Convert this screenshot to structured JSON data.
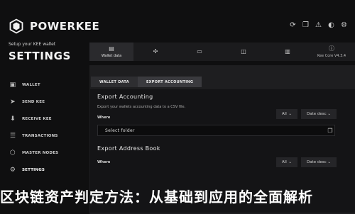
{
  "app": {
    "name": "POWERKEE",
    "subtitle": "Setup your KEE wallet",
    "page_title": "SETTINGS"
  },
  "top_icons": [
    "sync-icon",
    "copy-icon",
    "alert-icon",
    "brightness-icon",
    "settings-icon"
  ],
  "nav": [
    {
      "label": "WALLET",
      "icon": "wallet-icon"
    },
    {
      "label": "SEND KEE",
      "icon": "send-icon"
    },
    {
      "label": "RECEIVE KEE",
      "icon": "receive-icon"
    },
    {
      "label": "TRANSACTIONS",
      "icon": "transactions-icon"
    },
    {
      "label": "MASTER NODES",
      "icon": "masternodes-icon"
    },
    {
      "label": "SETTINGS",
      "icon": "settings-icon"
    }
  ],
  "tabs": [
    {
      "label": "Wallet data",
      "icon": "wallet-data-icon"
    },
    {
      "label": "",
      "icon": "network-icon"
    },
    {
      "label": "",
      "icon": "display-icon"
    },
    {
      "label": "",
      "icon": "lock-icon"
    },
    {
      "label": "",
      "icon": "debug-icon"
    },
    {
      "label": "Kee Core V4.3.4",
      "icon": "info-icon"
    }
  ],
  "panel_tabs": [
    "WALLET DATA",
    "EXPORT ACCOUNTING"
  ],
  "export_accounting": {
    "title": "Export Accounting",
    "description": "Export your wallets accounting data to a CSV file.",
    "where_label": "Where",
    "filter_all": "All",
    "filter_date": "Date desc",
    "folder_value": "Select folder"
  },
  "export_address_book": {
    "title": "Export Address Book",
    "where_label": "Where",
    "filter_all": "All",
    "filter_date": "Date desc"
  },
  "banner": "区块链资产判定方法：从基础到应用的全面解析"
}
